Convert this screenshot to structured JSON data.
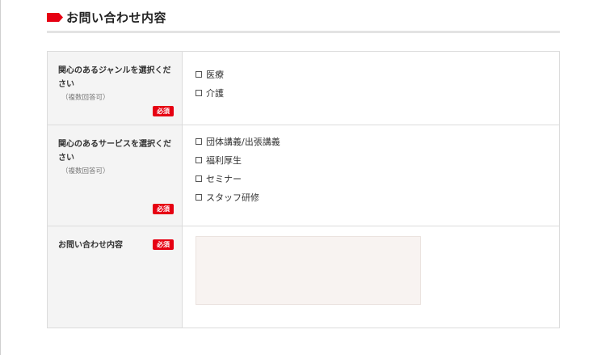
{
  "heading": {
    "title": "お問い合わせ内容",
    "marker_color": "#e60012"
  },
  "required_label": "必須",
  "rows": [
    {
      "label": "関心のあるジャンルを選択ください",
      "note": "（複数回答可）",
      "options": [
        "医療",
        "介護"
      ]
    },
    {
      "label": "関心のあるサービスを選択ください",
      "note": "（複数回答可）",
      "options": [
        "団体講義/出張講義",
        "福利厚生",
        "セミナー",
        "スタッフ研修"
      ]
    },
    {
      "label": "お問い合わせ内容",
      "textarea_value": ""
    }
  ]
}
